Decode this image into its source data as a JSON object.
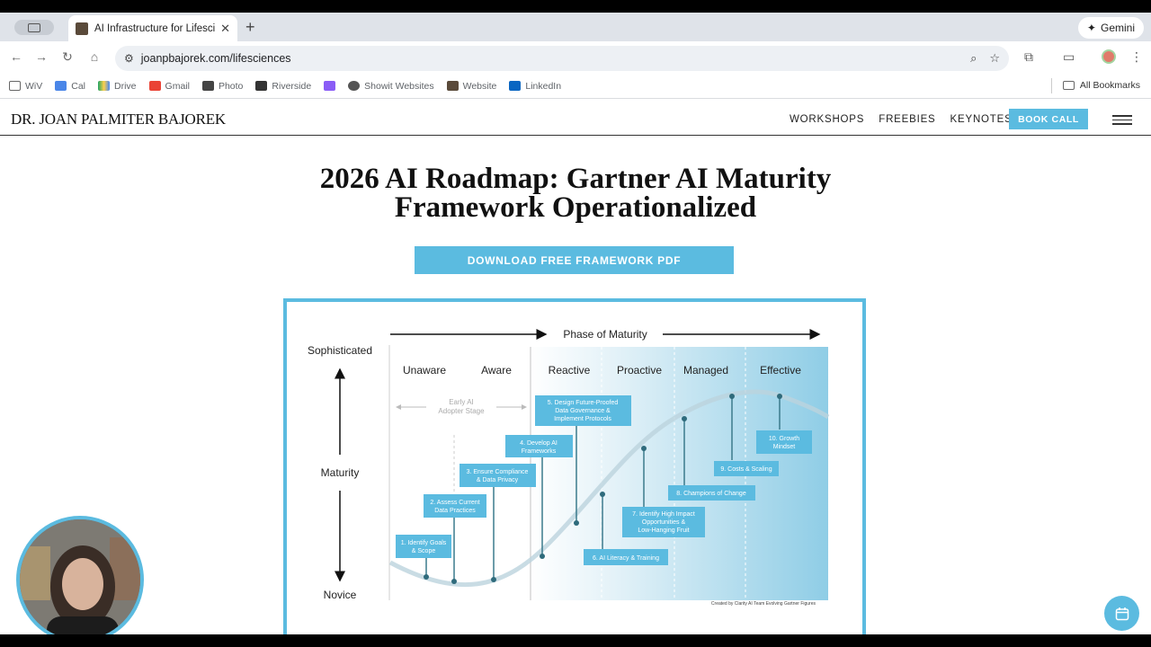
{
  "browser": {
    "tab_title": "AI Infrastructure for Lifescien",
    "tab_close": "✕",
    "new_tab": "+",
    "gemini_label": "Gemini",
    "url": "joanpbajorek.com/lifesciences",
    "bookmarks": [
      "WiV",
      "Cal",
      "Drive",
      "Gmail",
      "Photo",
      "Riverside",
      "Showit Websites",
      "Website",
      "LinkedIn"
    ],
    "all_bookmarks": "All Bookmarks"
  },
  "site": {
    "logo": "DR. JOAN PALMITER BAJOREK",
    "nav": [
      "WORKSHOPS",
      "FREEBIES",
      "KEYNOTES"
    ],
    "book_call": "BOOK CALL",
    "headline_line1": "2026 AI Roadmap: Gartner AI Maturity",
    "headline_line2": "Framework Operationalized",
    "download_button": "DOWNLOAD FREE FRAMEWORK PDF"
  },
  "figure": {
    "phase_title": "Phase of Maturity",
    "y_top": "Sophisticated",
    "y_mid": "Maturity",
    "y_bottom": "Novice",
    "phases": [
      "Unaware",
      "Aware",
      "Reactive",
      "Proactive",
      "Managed",
      "Effective"
    ],
    "early_stage_line1": "Early AI",
    "early_stage_line2": "Adopter Stage",
    "steps": [
      [
        "1. Identify Goals",
        "& Scope"
      ],
      [
        "2. Assess Current",
        "Data Practices"
      ],
      [
        "3. Ensure Compliance",
        "& Data Privacy"
      ],
      [
        "4. Develop AI",
        "Frameworks"
      ],
      [
        "5. Design Future-Proofed",
        "Data Governance &",
        "Implement Protocols"
      ],
      [
        "6. AI Literacy & Training"
      ],
      [
        "7. Identify High Impact",
        "Opportunities &",
        "Low-Hanging Fruit"
      ],
      [
        "8. Champions of Change"
      ],
      [
        "9. Costs & Scaling"
      ],
      [
        "10. Growth",
        "Mindset"
      ]
    ],
    "credit": "Created by Clarity AI Team Evolving Gartner Figures"
  }
}
